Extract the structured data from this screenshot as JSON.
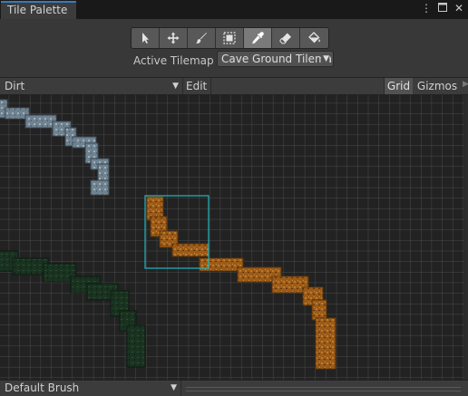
{
  "window": {
    "tab_title": "Tile Palette",
    "icons": [
      "more-vertical-icon",
      "maximize-icon",
      "close-icon"
    ]
  },
  "toolbar": {
    "tools": [
      {
        "name": "select-tool",
        "icon": "pointer-arrow-icon",
        "active": false
      },
      {
        "name": "move-tool",
        "icon": "move-arrows-icon",
        "active": false
      },
      {
        "name": "paint-tool",
        "icon": "paintbrush-icon",
        "active": false
      },
      {
        "name": "box-fill-tool",
        "icon": "box-select-icon",
        "active": false
      },
      {
        "name": "pick-tool",
        "icon": "eyedropper-icon",
        "active": true
      },
      {
        "name": "erase-tool",
        "icon": "eraser-icon",
        "active": false
      },
      {
        "name": "fill-tool",
        "icon": "paint-bucket-icon",
        "active": false
      }
    ],
    "active_tilemap_label": "Active Tilemap",
    "active_tilemap_value": "Cave Ground Tilemap"
  },
  "palette_bar": {
    "palette_value": "Dirt",
    "edit_label": "Edit",
    "grid_label": "Grid",
    "gizmos_label": "Gizmos"
  },
  "bottom_bar": {
    "brush_value": "Default Brush"
  },
  "colors": {
    "stone_tiles": "#8a9aa6",
    "dirt_tiles": "#b06a1e",
    "grass_tiles": "#1c3b24",
    "selection_outline": "#1fb8c0",
    "grid_lines": "#4a4a4a"
  }
}
